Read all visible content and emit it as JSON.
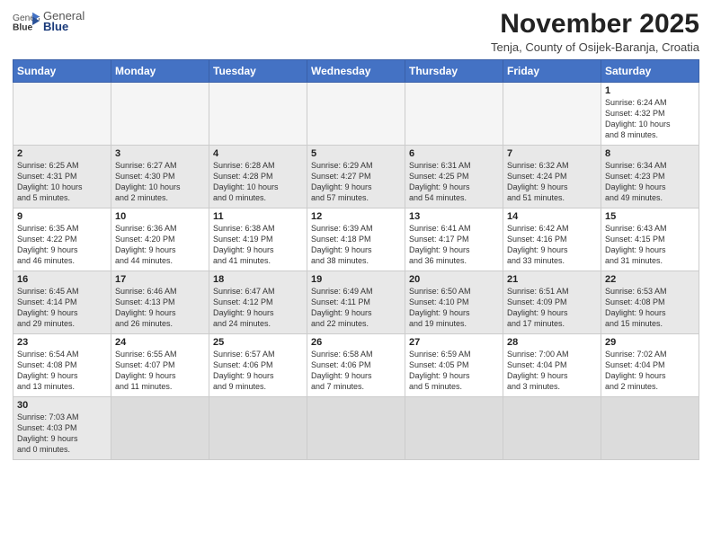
{
  "header": {
    "title": "November 2025",
    "location": "Tenja, County of Osijek-Baranja, Croatia"
  },
  "calendar": {
    "days": [
      "Sunday",
      "Monday",
      "Tuesday",
      "Wednesday",
      "Thursday",
      "Friday",
      "Saturday"
    ],
    "weeks": [
      [
        {
          "day": "",
          "info": ""
        },
        {
          "day": "",
          "info": ""
        },
        {
          "day": "",
          "info": ""
        },
        {
          "day": "",
          "info": ""
        },
        {
          "day": "",
          "info": ""
        },
        {
          "day": "",
          "info": ""
        },
        {
          "day": "1",
          "info": "Sunrise: 6:24 AM\nSunset: 4:32 PM\nDaylight: 10 hours\nand 8 minutes."
        }
      ],
      [
        {
          "day": "2",
          "info": "Sunrise: 6:25 AM\nSunset: 4:31 PM\nDaylight: 10 hours\nand 5 minutes."
        },
        {
          "day": "3",
          "info": "Sunrise: 6:27 AM\nSunset: 4:30 PM\nDaylight: 10 hours\nand 2 minutes."
        },
        {
          "day": "4",
          "info": "Sunrise: 6:28 AM\nSunset: 4:28 PM\nDaylight: 10 hours\nand 0 minutes."
        },
        {
          "day": "5",
          "info": "Sunrise: 6:29 AM\nSunset: 4:27 PM\nDaylight: 9 hours\nand 57 minutes."
        },
        {
          "day": "6",
          "info": "Sunrise: 6:31 AM\nSunset: 4:25 PM\nDaylight: 9 hours\nand 54 minutes."
        },
        {
          "day": "7",
          "info": "Sunrise: 6:32 AM\nSunset: 4:24 PM\nDaylight: 9 hours\nand 51 minutes."
        },
        {
          "day": "8",
          "info": "Sunrise: 6:34 AM\nSunset: 4:23 PM\nDaylight: 9 hours\nand 49 minutes."
        }
      ],
      [
        {
          "day": "9",
          "info": "Sunrise: 6:35 AM\nSunset: 4:22 PM\nDaylight: 9 hours\nand 46 minutes."
        },
        {
          "day": "10",
          "info": "Sunrise: 6:36 AM\nSunset: 4:20 PM\nDaylight: 9 hours\nand 44 minutes."
        },
        {
          "day": "11",
          "info": "Sunrise: 6:38 AM\nSunset: 4:19 PM\nDaylight: 9 hours\nand 41 minutes."
        },
        {
          "day": "12",
          "info": "Sunrise: 6:39 AM\nSunset: 4:18 PM\nDaylight: 9 hours\nand 38 minutes."
        },
        {
          "day": "13",
          "info": "Sunrise: 6:41 AM\nSunset: 4:17 PM\nDaylight: 9 hours\nand 36 minutes."
        },
        {
          "day": "14",
          "info": "Sunrise: 6:42 AM\nSunset: 4:16 PM\nDaylight: 9 hours\nand 33 minutes."
        },
        {
          "day": "15",
          "info": "Sunrise: 6:43 AM\nSunset: 4:15 PM\nDaylight: 9 hours\nand 31 minutes."
        }
      ],
      [
        {
          "day": "16",
          "info": "Sunrise: 6:45 AM\nSunset: 4:14 PM\nDaylight: 9 hours\nand 29 minutes."
        },
        {
          "day": "17",
          "info": "Sunrise: 6:46 AM\nSunset: 4:13 PM\nDaylight: 9 hours\nand 26 minutes."
        },
        {
          "day": "18",
          "info": "Sunrise: 6:47 AM\nSunset: 4:12 PM\nDaylight: 9 hours\nand 24 minutes."
        },
        {
          "day": "19",
          "info": "Sunrise: 6:49 AM\nSunset: 4:11 PM\nDaylight: 9 hours\nand 22 minutes."
        },
        {
          "day": "20",
          "info": "Sunrise: 6:50 AM\nSunset: 4:10 PM\nDaylight: 9 hours\nand 19 minutes."
        },
        {
          "day": "21",
          "info": "Sunrise: 6:51 AM\nSunset: 4:09 PM\nDaylight: 9 hours\nand 17 minutes."
        },
        {
          "day": "22",
          "info": "Sunrise: 6:53 AM\nSunset: 4:08 PM\nDaylight: 9 hours\nand 15 minutes."
        }
      ],
      [
        {
          "day": "23",
          "info": "Sunrise: 6:54 AM\nSunset: 4:08 PM\nDaylight: 9 hours\nand 13 minutes."
        },
        {
          "day": "24",
          "info": "Sunrise: 6:55 AM\nSunset: 4:07 PM\nDaylight: 9 hours\nand 11 minutes."
        },
        {
          "day": "25",
          "info": "Sunrise: 6:57 AM\nSunset: 4:06 PM\nDaylight: 9 hours\nand 9 minutes."
        },
        {
          "day": "26",
          "info": "Sunrise: 6:58 AM\nSunset: 4:06 PM\nDaylight: 9 hours\nand 7 minutes."
        },
        {
          "day": "27",
          "info": "Sunrise: 6:59 AM\nSunset: 4:05 PM\nDaylight: 9 hours\nand 5 minutes."
        },
        {
          "day": "28",
          "info": "Sunrise: 7:00 AM\nSunset: 4:04 PM\nDaylight: 9 hours\nand 3 minutes."
        },
        {
          "day": "29",
          "info": "Sunrise: 7:02 AM\nSunset: 4:04 PM\nDaylight: 9 hours\nand 2 minutes."
        }
      ],
      [
        {
          "day": "30",
          "info": "Sunrise: 7:03 AM\nSunset: 4:03 PM\nDaylight: 9 hours\nand 0 minutes."
        },
        {
          "day": "",
          "info": ""
        },
        {
          "day": "",
          "info": ""
        },
        {
          "day": "",
          "info": ""
        },
        {
          "day": "",
          "info": ""
        },
        {
          "day": "",
          "info": ""
        },
        {
          "day": "",
          "info": ""
        }
      ]
    ]
  }
}
